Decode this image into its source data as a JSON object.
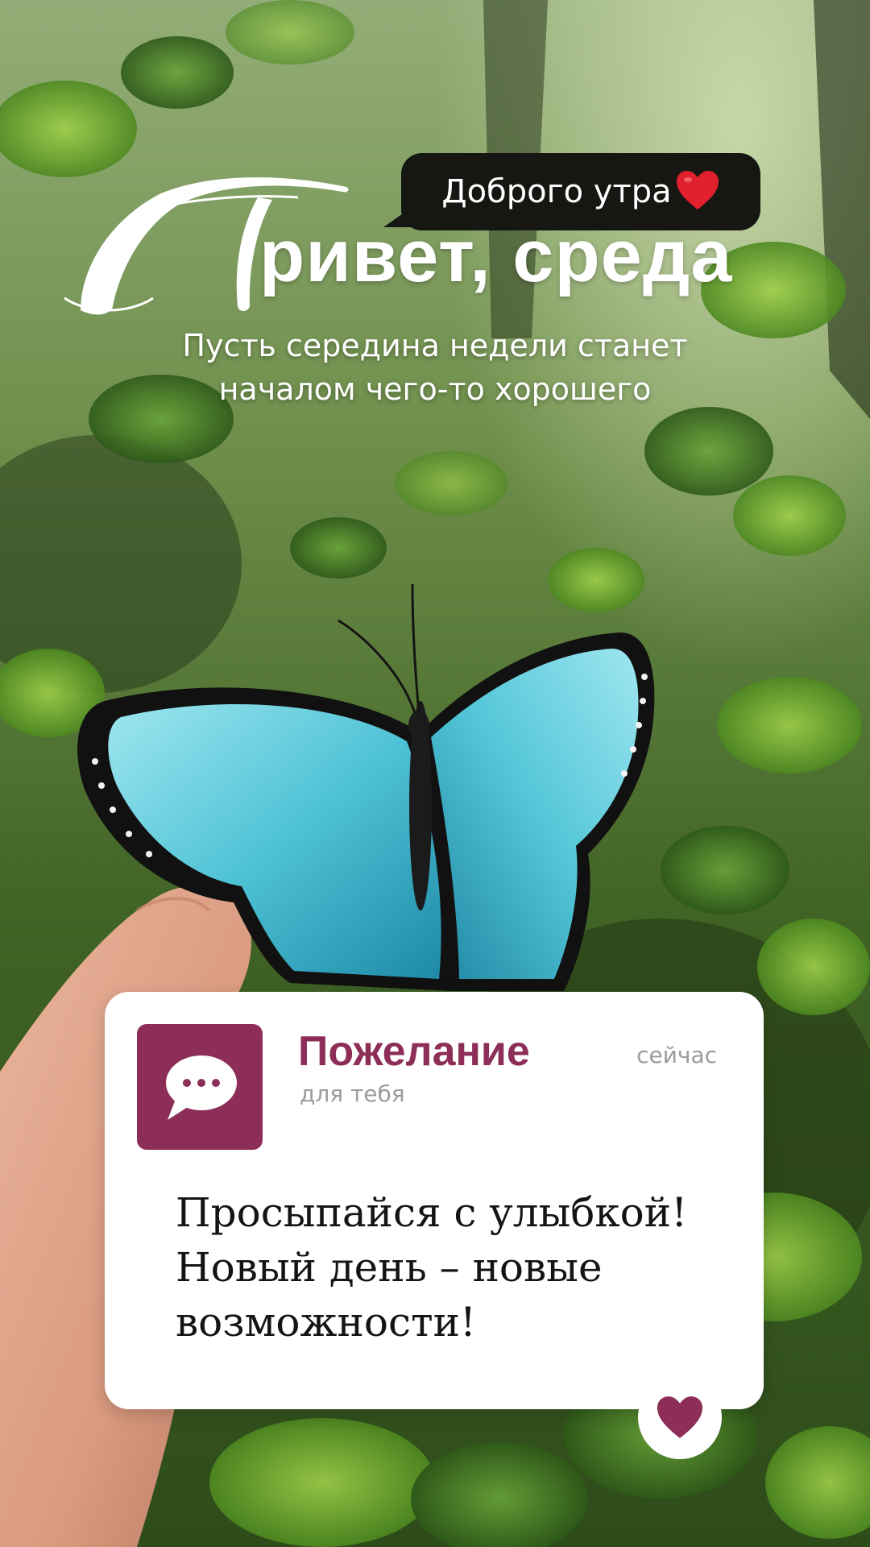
{
  "bubble": {
    "text": "Доброго утра"
  },
  "header": {
    "title_initial": "П",
    "title_rest": "ривет, среда",
    "subtitle_line1": "Пусть середина недели станет",
    "subtitle_line2": "началом чего-то хорошего"
  },
  "notification": {
    "title": "Пожелание",
    "subtitle": "для тебя",
    "time": "сейчас",
    "message_line1": "Просыпайся с улыбкой!",
    "message_line2": "Новый день – новые",
    "message_line3": "возможности!"
  },
  "icons": {
    "bubble_icon": "heart-emoji-icon",
    "card_icon": "chat-bubble-icon",
    "like_icon": "heart-icon"
  },
  "colors": {
    "accent": "#8c2e57",
    "bubble_bg": "#161712",
    "heart_red": "#e0202c"
  }
}
